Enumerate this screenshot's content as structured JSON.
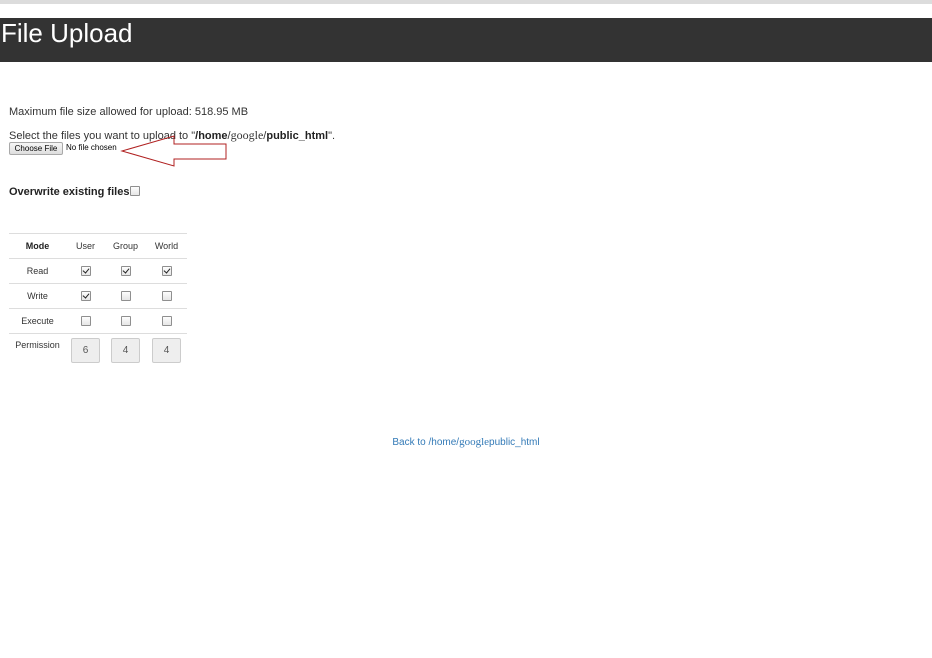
{
  "header": {
    "title": "File Upload"
  },
  "upload": {
    "max_size_text": "Maximum file size allowed for upload: 518.95 MB",
    "select_prefix": "Select the files you want to upload to \"",
    "path_home": "/home",
    "path_sep1": "/",
    "path_user": "google",
    "path_sep2": "/",
    "path_dir": "public_html",
    "select_suffix": "\".",
    "choose_file_label": "Choose File",
    "no_file_text": "No file chosen"
  },
  "overwrite": {
    "label": "Overwrite existing files:",
    "checked": false
  },
  "permissions": {
    "headers": [
      "Mode",
      "User",
      "Group",
      "World"
    ],
    "rows": [
      {
        "label": "Read",
        "values": [
          true,
          true,
          true
        ]
      },
      {
        "label": "Write",
        "values": [
          true,
          false,
          false
        ]
      },
      {
        "label": "Execute",
        "values": [
          false,
          false,
          false
        ]
      }
    ],
    "permission_label": "Permission",
    "permission_values": [
      "6",
      "4",
      "4"
    ]
  },
  "back": {
    "prefix": "Back to /home/",
    "user": "google",
    "suffix": "public_html"
  }
}
